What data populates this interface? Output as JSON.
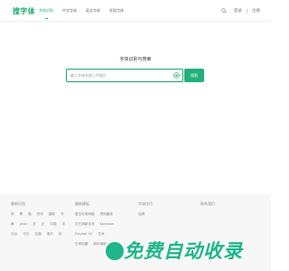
{
  "brand": {
    "logo": "搜字体",
    "accent": "#1aa86b"
  },
  "nav": {
    "items": [
      "字体识别",
      "中文字体",
      "英文字体",
      "发现字体"
    ]
  },
  "header": {
    "login": "登录",
    "register": "注册"
  },
  "hero": {
    "title": "字体识别与搜索",
    "placeholder": "输入字体名称上传图片",
    "button": "搜索"
  },
  "footer": {
    "col1": {
      "title": "最新识别",
      "items": [
        "宋",
        "黑",
        "楷",
        "仿宋",
        "圆体",
        "书",
        "隶",
        "pixel",
        "方",
        "正",
        "中国",
        "字",
        "汉仪",
        "华文",
        "文鼎",
        "造字",
        "站"
      ]
    },
    "col2": {
      "title": "最新模板",
      "items": [
        "复古毛笔风格",
        "漂亮圆体",
        "文艺清新手写",
        "Kartwian",
        "Playfair SC",
        "艺术",
        "古风标题",
        "新年海报",
        "功能"
      ]
    },
    "col3": {
      "title": "字体技巧",
      "items": [
        "品牌"
      ]
    },
    "col4": {
      "title": "联系我们",
      "items": []
    }
  },
  "watermark": {
    "text": "免费自动收录"
  }
}
